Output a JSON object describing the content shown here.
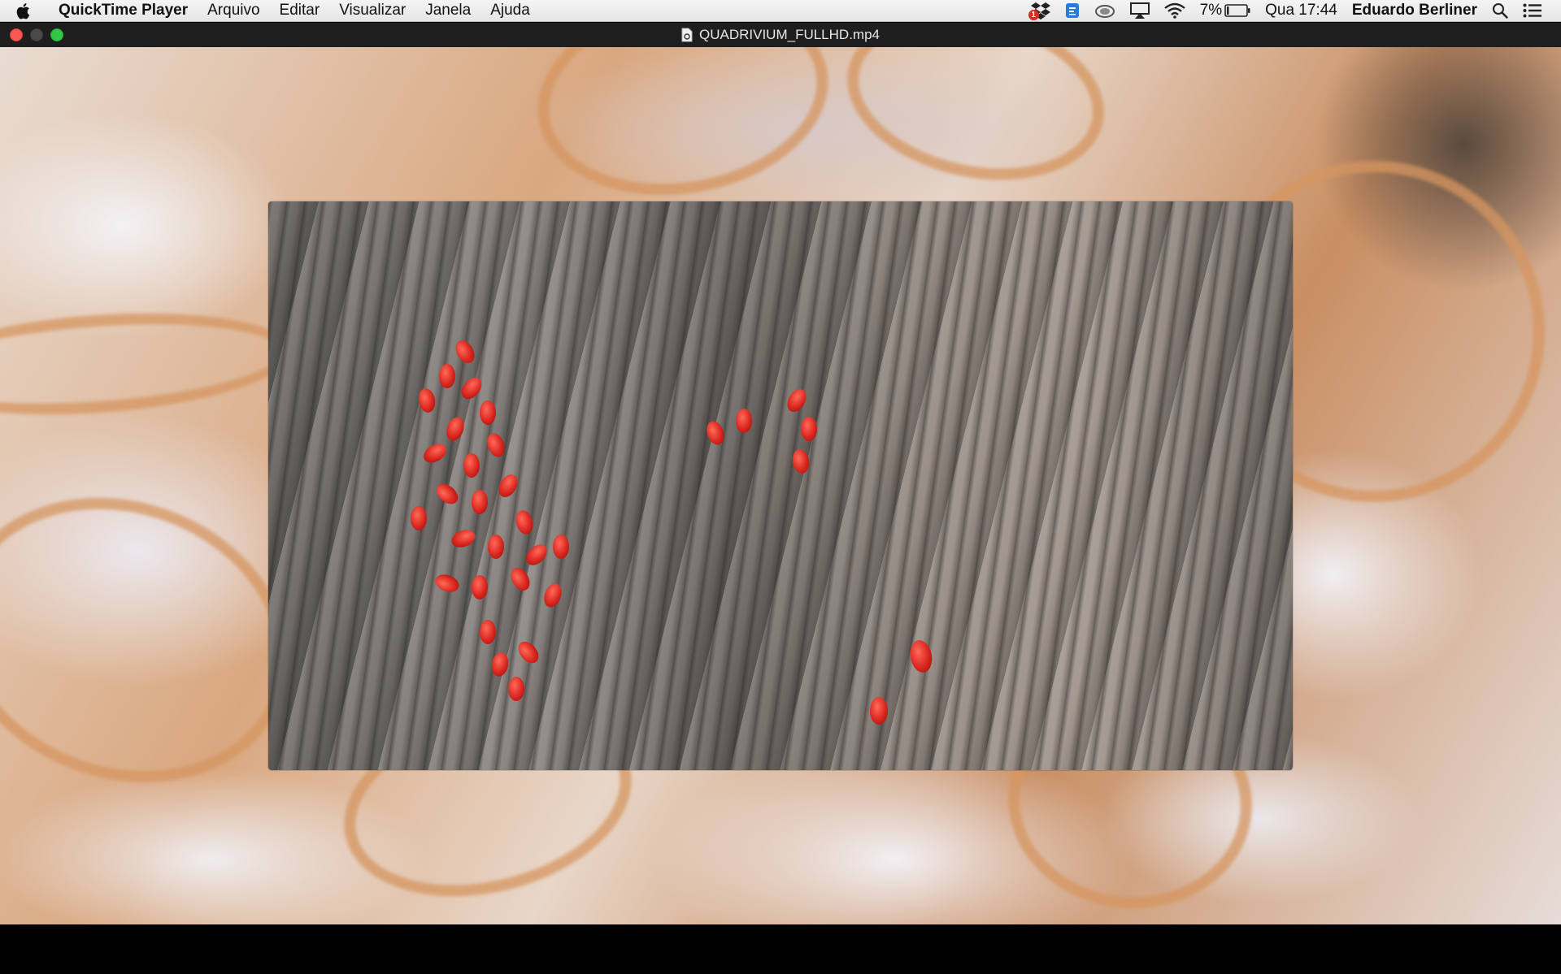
{
  "menubar": {
    "app_name": "QuickTime Player",
    "menus": [
      "Arquivo",
      "Editar",
      "Visualizar",
      "Janela",
      "Ajuda"
    ],
    "status": {
      "battery_percent": "7%",
      "clock": "Qua 17:44",
      "user": "Eduardo Berliner",
      "dropbox_badge": "1"
    },
    "icons": [
      "apple-icon",
      "dropbox-icon",
      "app-indicator-icon",
      "cloud-sync-icon",
      "airplay-icon",
      "wifi-icon",
      "battery-icon",
      "spotlight-icon",
      "notification-center-icon"
    ]
  },
  "window": {
    "title": "QUADRIVIUM_FULLHD.mp4",
    "buttons": [
      "close",
      "minimize",
      "zoom"
    ]
  },
  "colors": {
    "menubar_bg": "#ececec",
    "titlebar_bg": "#1e1e1e",
    "close": "#fc5753",
    "zoom": "#33c748"
  }
}
